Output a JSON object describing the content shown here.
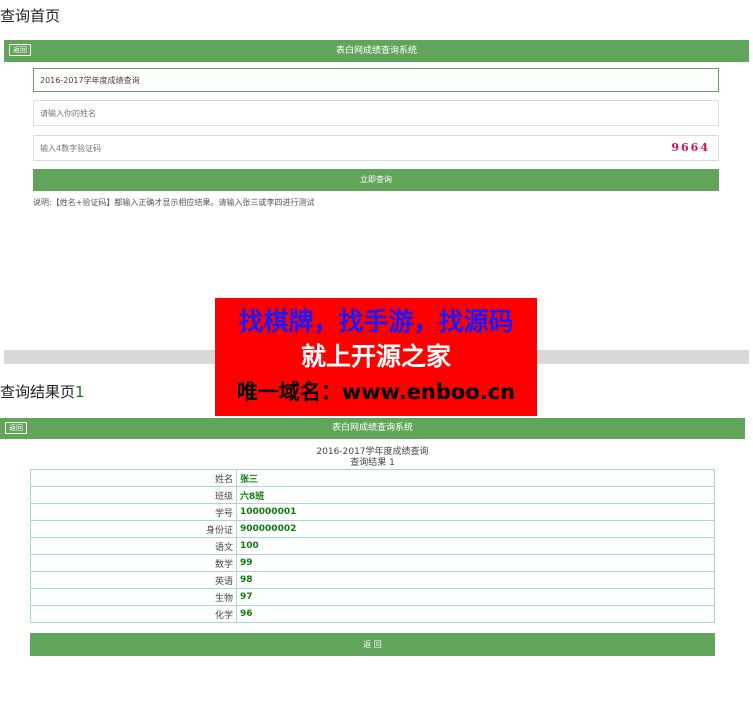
{
  "query_page": {
    "section_title": "查询首页",
    "header": {
      "back_label": "返回",
      "title": "表白网成绩查询系统"
    },
    "exam_field": {
      "value": "2016-2017学年度成绩查询"
    },
    "name_field": {
      "placeholder": "请输入你的姓名"
    },
    "captcha_field": {
      "placeholder": "输入4数字验证码",
      "captcha": "9664"
    },
    "submit_label": "立即查询",
    "note": "说明:【姓名+验证码】都输入正确才显示相应结果。请输入张三或李四进行测试"
  },
  "ad_banner": {
    "line1": "找棋牌，找手游，找源码",
    "line2": "就上开源之家",
    "line3": "唯一域名：www.enboo.cn"
  },
  "result_page": {
    "section_title": "查询结果页",
    "section_num": "1",
    "header": {
      "back_label": "返回",
      "title": "表白网成绩查询系统"
    },
    "exam_title": "2016-2017学年度成绩查询",
    "result_title": "查询结果 1",
    "rows": [
      {
        "label": "姓名",
        "value": "张三"
      },
      {
        "label": "班级",
        "value": "六8班"
      },
      {
        "label": "学号",
        "value": "100000001"
      },
      {
        "label": "身份证",
        "value": "900000002"
      },
      {
        "label": "语文",
        "value": "100"
      },
      {
        "label": "数学",
        "value": "99"
      },
      {
        "label": "英语",
        "value": "98"
      },
      {
        "label": "生物",
        "value": "97"
      },
      {
        "label": "化学",
        "value": "96"
      }
    ],
    "back_label": "返 回"
  }
}
